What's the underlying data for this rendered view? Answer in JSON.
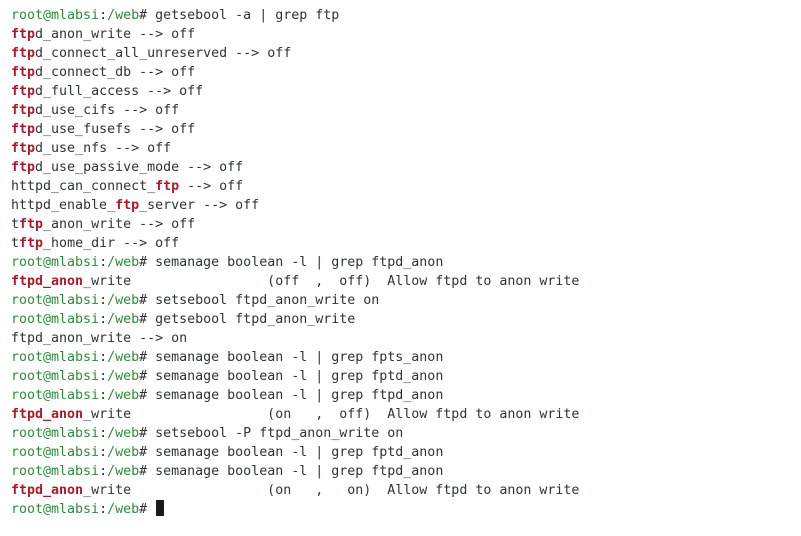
{
  "colors": {
    "background": "#ffffff",
    "text": "#2e3436",
    "prompt": "#2e8b3a",
    "highlight": "#b0182a"
  },
  "prompt": {
    "user_host": "root@mlabsi",
    "separator": ":",
    "path": "/web",
    "symbol": "# "
  },
  "lines": [
    {
      "type": "prompt",
      "text": "getsebool -a | grep ftp"
    },
    {
      "type": "output",
      "segments": [
        {
          "t": "ftp",
          "hl": true
        },
        {
          "t": "d_anon_write --> off"
        }
      ]
    },
    {
      "type": "output",
      "segments": [
        {
          "t": "ftp",
          "hl": true
        },
        {
          "t": "d_connect_all_unreserved --> off"
        }
      ]
    },
    {
      "type": "output",
      "segments": [
        {
          "t": "ftp",
          "hl": true
        },
        {
          "t": "d_connect_db --> off"
        }
      ]
    },
    {
      "type": "output",
      "segments": [
        {
          "t": "ftp",
          "hl": true
        },
        {
          "t": "d_full_access --> off"
        }
      ]
    },
    {
      "type": "output",
      "segments": [
        {
          "t": "ftp",
          "hl": true
        },
        {
          "t": "d_use_cifs --> off"
        }
      ]
    },
    {
      "type": "output",
      "segments": [
        {
          "t": "ftp",
          "hl": true
        },
        {
          "t": "d_use_fusefs --> off"
        }
      ]
    },
    {
      "type": "output",
      "segments": [
        {
          "t": "ftp",
          "hl": true
        },
        {
          "t": "d_use_nfs --> off"
        }
      ]
    },
    {
      "type": "output",
      "segments": [
        {
          "t": "ftp",
          "hl": true
        },
        {
          "t": "d_use_passive_mode --> off"
        }
      ]
    },
    {
      "type": "output",
      "segments": [
        {
          "t": "httpd_can_connect_"
        },
        {
          "t": "ftp",
          "hl": true
        },
        {
          "t": " --> off"
        }
      ]
    },
    {
      "type": "output",
      "segments": [
        {
          "t": "httpd_enable_"
        },
        {
          "t": "ftp",
          "hl": true
        },
        {
          "t": "_server --> off"
        }
      ]
    },
    {
      "type": "output",
      "segments": [
        {
          "t": "t"
        },
        {
          "t": "ftp",
          "hl": true
        },
        {
          "t": "_anon_write --> off"
        }
      ]
    },
    {
      "type": "output",
      "segments": [
        {
          "t": "t"
        },
        {
          "t": "ftp",
          "hl": true
        },
        {
          "t": "_home_dir --> off"
        }
      ]
    },
    {
      "type": "prompt",
      "text": "semanage boolean -l | grep ftpd_anon"
    },
    {
      "type": "output",
      "segments": [
        {
          "t": "ftpd_anon",
          "hl": true
        },
        {
          "t": "_write                 (off  ,  off)  Allow ftpd to anon write"
        }
      ]
    },
    {
      "type": "prompt",
      "text": "setsebool ftpd_anon_write on"
    },
    {
      "type": "prompt",
      "text": "getsebool ftpd_anon_write"
    },
    {
      "type": "output",
      "segments": [
        {
          "t": "ftpd_anon_write --> on"
        }
      ]
    },
    {
      "type": "prompt",
      "text": "semanage boolean -l | grep fpts_anon"
    },
    {
      "type": "prompt",
      "text": "semanage boolean -l | grep fptd_anon"
    },
    {
      "type": "prompt",
      "text": "semanage boolean -l | grep ftpd_anon"
    },
    {
      "type": "output",
      "segments": [
        {
          "t": "ftpd_anon",
          "hl": true
        },
        {
          "t": "_write                 (on   ,  off)  Allow ftpd to anon write"
        }
      ]
    },
    {
      "type": "prompt",
      "text": "setsebool -P ftpd_anon_write on"
    },
    {
      "type": "prompt",
      "text": "semanage boolean -l | grep fptd_anon"
    },
    {
      "type": "prompt",
      "text": "semanage boolean -l | grep ftpd_anon"
    },
    {
      "type": "output",
      "segments": [
        {
          "t": "ftpd_anon",
          "hl": true
        },
        {
          "t": "_write                 (on   ,   on)  Allow ftpd to anon write"
        }
      ]
    },
    {
      "type": "prompt",
      "text": "",
      "cursor": true
    }
  ]
}
